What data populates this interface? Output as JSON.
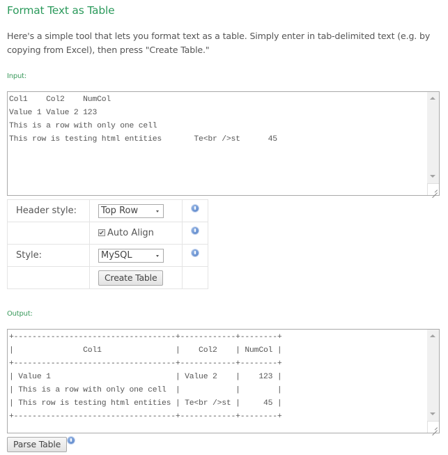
{
  "page": {
    "title": "Format Text as Table",
    "intro": "Here's a simple tool that lets you format text as a table. Simply enter in tab-delimited text (e.g. by copying from Excel), then press \"Create Table.\""
  },
  "input": {
    "label": "Input:",
    "value": "Col1\tCol2\tNumCol\nValue 1 Value 2 123\nThis is a row with only one cell\nThis row is testing html entities\tTe<br />st\t45"
  },
  "options": {
    "header_style": {
      "label": "Header style:",
      "selected": "Top Row",
      "info_icon": "info-icon"
    },
    "auto_align": {
      "label": "Auto Align",
      "checked": true,
      "info_icon": "info-icon"
    },
    "style": {
      "label": "Style:",
      "selected": "MySQL",
      "info_icon": "info-icon"
    },
    "create_button": "Create Table"
  },
  "output": {
    "label": "Output:",
    "value": "+-----------------------------------+------------+--------+\n|               Col1                |    Col2    | NumCol |\n+-----------------------------------+------------+--------+\n| Value 1                           | Value 2    |    123 |\n| This is a row with only one cell  |            |        |\n| This row is testing html entities | Te<br />st |     45 |\n+-----------------------------------+------------+--------+"
  },
  "parse": {
    "button": "Parse Table",
    "info_icon": "info-icon"
  },
  "colors": {
    "title": "#2c9a5c",
    "label": "#3a9a5c",
    "text": "#555555",
    "info_icon": "#4a78c2"
  }
}
